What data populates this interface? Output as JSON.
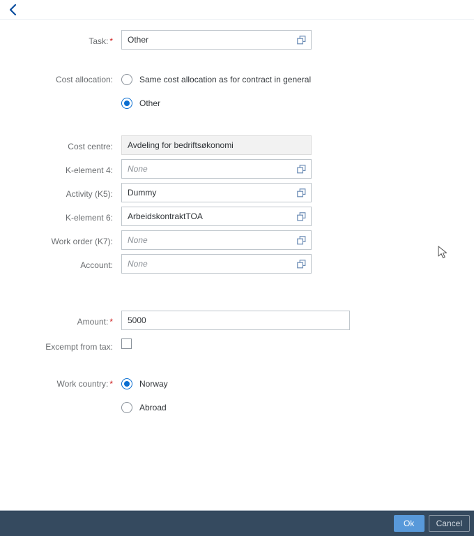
{
  "header": {
    "back_icon": "chevron-left-icon"
  },
  "form": {
    "task": {
      "label": "Task:",
      "required": true,
      "value": "Other",
      "placeholder": "",
      "icon": "value-help-icon"
    },
    "cost_allocation": {
      "label": "Cost allocation:",
      "required": false,
      "options": [
        {
          "label": "Same cost allocation as for contract in general",
          "selected": false
        },
        {
          "label": "Other",
          "selected": true
        }
      ]
    },
    "cost_centre": {
      "label": "Cost centre:",
      "required": false,
      "value": "Avdeling for bedriftsøkonomi",
      "readonly": true
    },
    "k_element_4": {
      "label": "K-element 4:",
      "required": false,
      "value": "None",
      "is_placeholder": true,
      "icon": "value-help-icon"
    },
    "activity_k5": {
      "label": "Activity (K5):",
      "required": false,
      "value": "Dummy",
      "is_placeholder": false,
      "icon": "value-help-icon"
    },
    "k_element_6": {
      "label": "K-element 6:",
      "required": false,
      "value": "ArbeidskontraktTOA",
      "is_placeholder": false,
      "icon": "value-help-icon"
    },
    "work_order_k7": {
      "label": "Work order (K7):",
      "required": false,
      "value": "None",
      "is_placeholder": true,
      "icon": "value-help-icon"
    },
    "account": {
      "label": "Account:",
      "required": false,
      "value": "None",
      "is_placeholder": true,
      "icon": "value-help-icon"
    },
    "amount": {
      "label": "Amount:",
      "required": true,
      "value": "5000"
    },
    "excempt_from_tax": {
      "label": "Excempt from tax:",
      "checked": false
    },
    "work_country": {
      "label": "Work country:",
      "required": true,
      "options": [
        {
          "label": "Norway",
          "selected": true
        },
        {
          "label": "Abroad",
          "selected": false
        }
      ]
    }
  },
  "footer": {
    "ok_label": "Ok",
    "cancel_label": "Cancel"
  },
  "colors": {
    "accent_blue": "#0a6ed1",
    "footer_bg": "#354a5f",
    "ok_button": "#5899da",
    "required_asterisk": "#cc1919",
    "label_text": "#6a6d70",
    "readonly_bg": "#f2f2f2"
  }
}
